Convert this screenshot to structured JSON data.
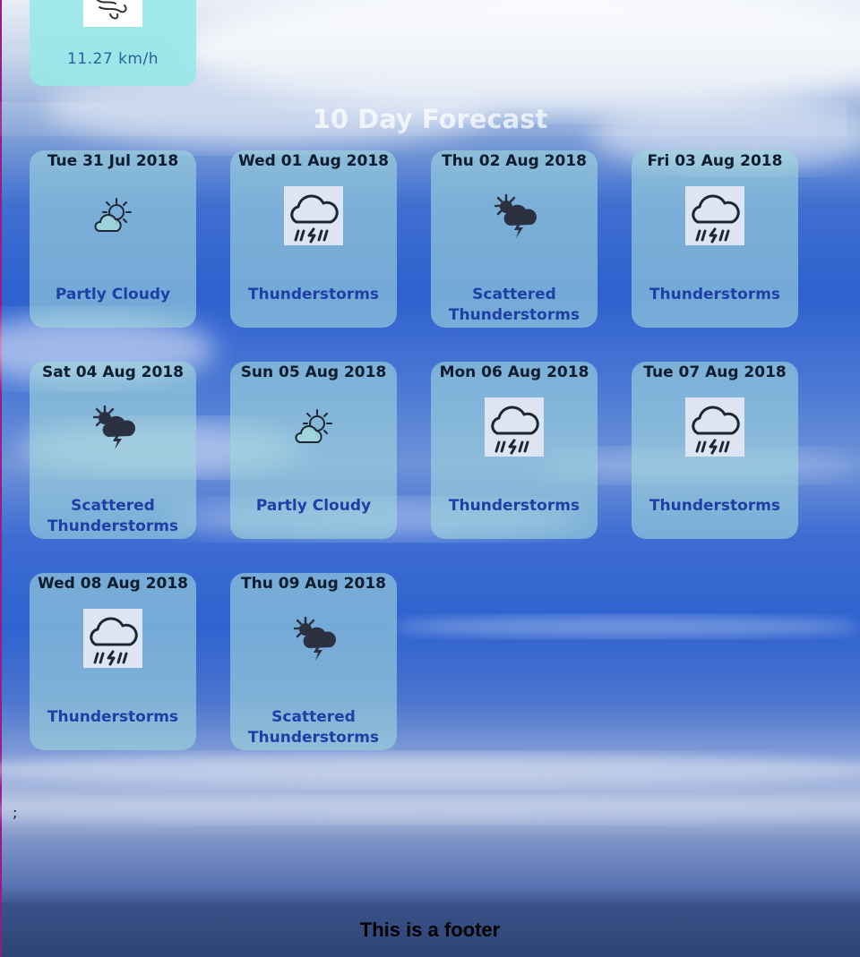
{
  "wind": {
    "icon": "wind-icon",
    "speed": "11.27 km/h"
  },
  "forecast": {
    "title": "10 Day Forecast",
    "days": [
      {
        "date": "Tue 31 Jul 2018",
        "condition": "Partly Cloudy",
        "icon": "partly-cloudy-icon"
      },
      {
        "date": "Wed 01 Aug 2018",
        "condition": "Thunderstorms",
        "icon": "thunderstorm-icon"
      },
      {
        "date": "Thu 02 Aug 2018",
        "condition": "Scattered Thunderstorms",
        "icon": "scattered-thunderstorms-icon"
      },
      {
        "date": "Fri 03 Aug 2018",
        "condition": "Thunderstorms",
        "icon": "thunderstorm-icon"
      },
      {
        "date": "Sat 04 Aug 2018",
        "condition": "Scattered Thunderstorms",
        "icon": "scattered-thunderstorms-icon"
      },
      {
        "date": "Sun 05 Aug 2018",
        "condition": "Partly Cloudy",
        "icon": "partly-cloudy-icon"
      },
      {
        "date": "Mon 06 Aug 2018",
        "condition": "Thunderstorms",
        "icon": "thunderstorm-icon"
      },
      {
        "date": "Tue 07 Aug 2018",
        "condition": "Thunderstorms",
        "icon": "thunderstorm-icon"
      },
      {
        "date": "Wed 08 Aug 2018",
        "condition": "Thunderstorms",
        "icon": "thunderstorm-icon"
      },
      {
        "date": "Thu 09 Aug 2018",
        "condition": "Scattered Thunderstorms",
        "icon": "scattered-thunderstorms-icon"
      }
    ]
  },
  "stray_text": ";",
  "footer": {
    "text": "This is a footer"
  }
}
